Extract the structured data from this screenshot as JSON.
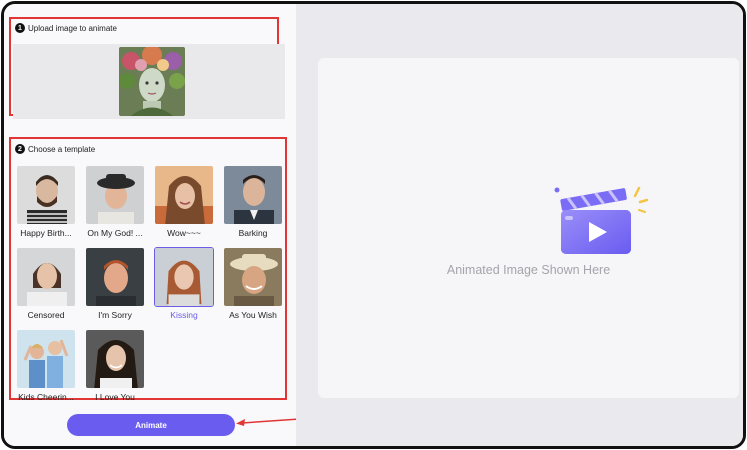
{
  "upload": {
    "step": "1",
    "title": "Upload image to animate"
  },
  "templates": {
    "step": "2",
    "title": "Choose a template",
    "items": [
      {
        "label": "Happy Birth...",
        "selected": false
      },
      {
        "label": "On My God! ...",
        "selected": false
      },
      {
        "label": "Wow~~~",
        "selected": false
      },
      {
        "label": "Barking",
        "selected": false
      },
      {
        "label": "Censored",
        "selected": false
      },
      {
        "label": "I'm Sorry",
        "selected": false
      },
      {
        "label": "Kissing",
        "selected": true
      },
      {
        "label": "As You Wish",
        "selected": false
      },
      {
        "label": "Kids Cheerin...",
        "selected": false
      },
      {
        "label": "I Love You",
        "selected": false
      }
    ]
  },
  "actions": {
    "animate_label": "Animate"
  },
  "preview": {
    "placeholder": "Animated Image Shown Here"
  },
  "colors": {
    "accent": "#6b5cf0",
    "highlight_border": "#e23535"
  }
}
